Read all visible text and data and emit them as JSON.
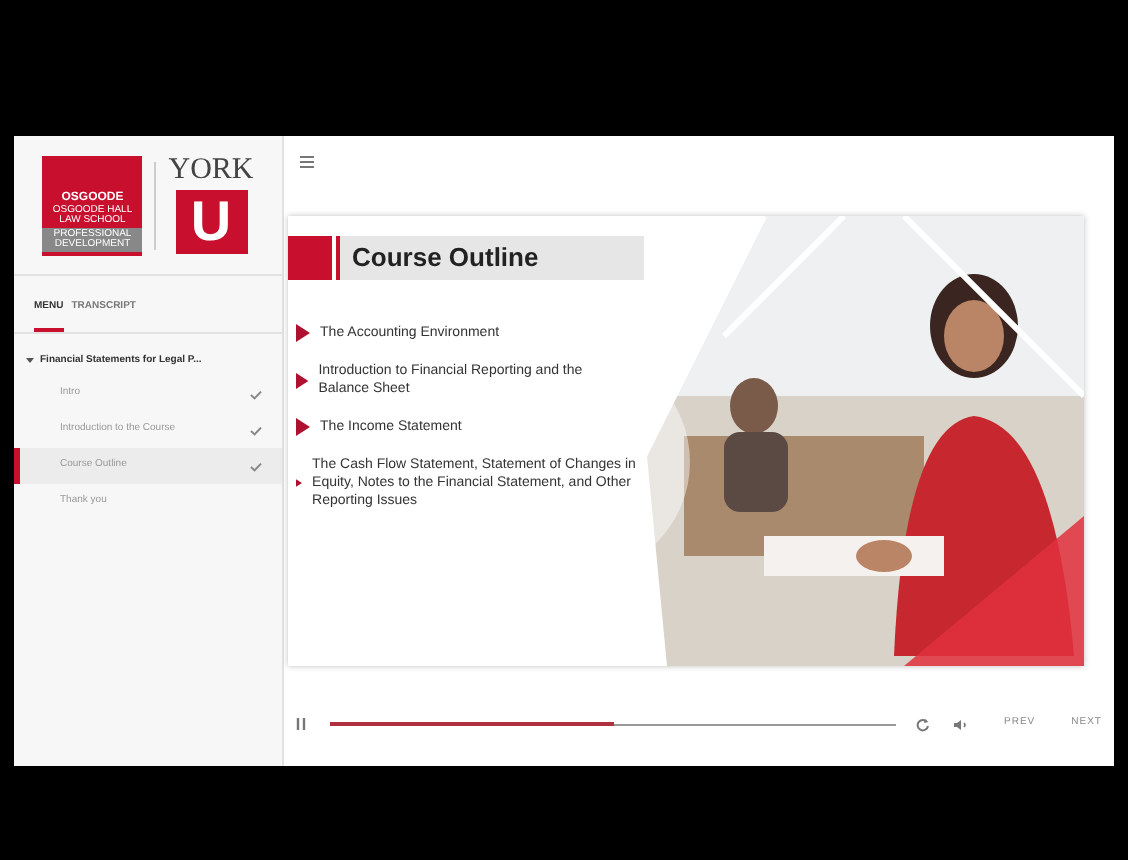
{
  "logo": {
    "school": "OSGOODE",
    "school_sub": "OSGOODE HALL LAW SCHOOL",
    "unit": "PROFESSIONAL DEVELOPMENT",
    "university": "YORK",
    "letter": "U"
  },
  "sidebar": {
    "tabs": [
      {
        "label": "MENU",
        "selected": true
      },
      {
        "label": "TRANSCRIPT",
        "selected": false
      }
    ],
    "tree": [
      {
        "label": "Financial Statements for Legal P...",
        "expanded": true,
        "children": [
          {
            "label": "Intro",
            "done": true,
            "selected": false
          },
          {
            "label": "Introduction to the Course",
            "done": true,
            "selected": false
          },
          {
            "label": "Course Outline",
            "done": true,
            "selected": true
          },
          {
            "label": "Thank you",
            "done": false,
            "selected": false
          }
        ]
      }
    ]
  },
  "slide": {
    "title": "Course Outline",
    "bullets": [
      "The Accounting Environment",
      "Introduction to Financial Reporting and the Balance Sheet",
      "The Income Statement",
      "The Cash Flow Statement, Statement of Changes in Equity, Notes to the Financial Statement, and Other Reporting Issues"
    ]
  },
  "player": {
    "playing": true,
    "progress": {
      "level": 0.5
    },
    "buttons": [
      "PREV",
      "NEXT"
    ]
  }
}
